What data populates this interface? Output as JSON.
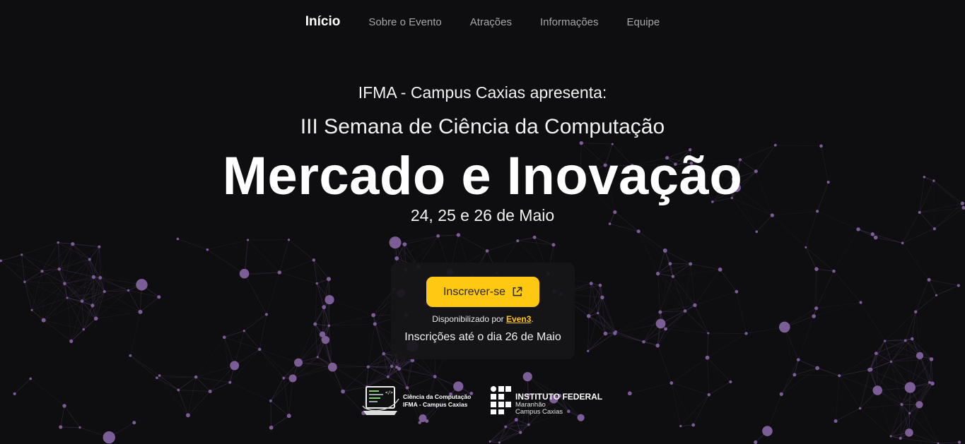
{
  "nav": {
    "items": [
      {
        "label": "Início",
        "active": true
      },
      {
        "label": "Sobre o Evento",
        "active": false
      },
      {
        "label": "Atrações",
        "active": false
      },
      {
        "label": "Informações",
        "active": false
      },
      {
        "label": "Equipe",
        "active": false
      }
    ]
  },
  "hero": {
    "kicker": "IFMA - Campus Caxias apresenta:",
    "subtitle": "III Semana de Ciência da Computação",
    "title": "Mercado e Inovação",
    "dates": "24, 25 e 26 de Maio"
  },
  "signup": {
    "button_label": "Inscrever-se",
    "button_icon": "external-link-icon",
    "powered_prefix": "Disponibilizado por ",
    "powered_brand": "Even3",
    "powered_suffix": ".",
    "deadline": "Inscrições até o dia 26 de Maio"
  },
  "logos": {
    "course": {
      "line1": "Ciência da Computação",
      "line2": "IFMA - Campus Caxias",
      "icon": "laptop-code-icon"
    },
    "institute": {
      "line1": "INSTITUTO FEDERAL",
      "line2": "Maranhão",
      "line3": "Campus Caxias",
      "icon": "if-grid-logo-icon"
    }
  },
  "colors": {
    "background": "#0e0d0f",
    "accent": "#ffc812",
    "network_node": "#7b5e96",
    "network_line": "#4a3a5c",
    "nav_inactive": "#a7a5ab"
  }
}
